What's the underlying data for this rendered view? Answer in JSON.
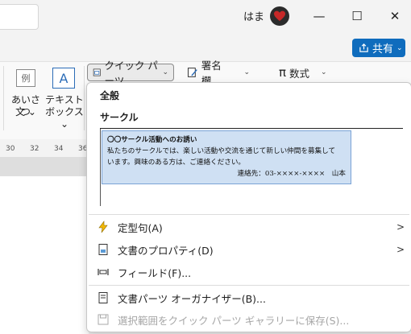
{
  "titlebar": {
    "user_name": "はま",
    "minimize": "—",
    "maximize": "☐",
    "close": "✕"
  },
  "share_button": {
    "label": "共有",
    "chevron": "⌄"
  },
  "ribbon": {
    "greeting": {
      "icon_text": "例",
      "line1": "あいさつ",
      "line2": "文 ⌄"
    },
    "textbox": {
      "icon_text": "A",
      "line1": "テキスト",
      "line2": "ボックス ⌄"
    },
    "quick_parts": {
      "label": "クイック パーツ",
      "chevron": "⌄"
    },
    "signature": {
      "label": "署名欄",
      "chevron": "⌄"
    },
    "equation": {
      "icon_text": "π",
      "label": "数式",
      "chevron": "⌄"
    }
  },
  "ruler": [
    "30",
    "32",
    "34",
    "36"
  ],
  "menu": {
    "section_general": "全般",
    "section_circle": "サークル",
    "gallery_item": {
      "title": "〇〇サークル活動へのお誘い",
      "body1": "私たちのサークルでは、楽しい活動や交流を通じて新しい仲間を募集して",
      "body2": "います。興味のある方は、ご連絡ください。",
      "contact": "連絡先：03-××××-××××　山本"
    },
    "items": [
      {
        "label": "定型句(A)",
        "icon": "autotext-icon",
        "has_submenu": true,
        "enabled": true
      },
      {
        "label": "文書のプロパティ(D)",
        "icon": "document-property-icon",
        "has_submenu": true,
        "enabled": true
      },
      {
        "label": "フィールド(F)...",
        "icon": "field-icon",
        "has_submenu": false,
        "enabled": true
      },
      {
        "label": "文書パーツ オーガナイザー(B)...",
        "icon": "organizer-icon",
        "has_submenu": false,
        "enabled": true
      },
      {
        "label": "選択範囲をクイック パーツ ギャラリーに保存(S)...",
        "icon": "save-icon",
        "has_submenu": false,
        "enabled": false
      }
    ],
    "submenu_arrow": ">"
  },
  "colors": {
    "accent": "#0f6cbd",
    "gallery_fill": "#cfe0f3",
    "gallery_border": "#7aa3d6"
  }
}
